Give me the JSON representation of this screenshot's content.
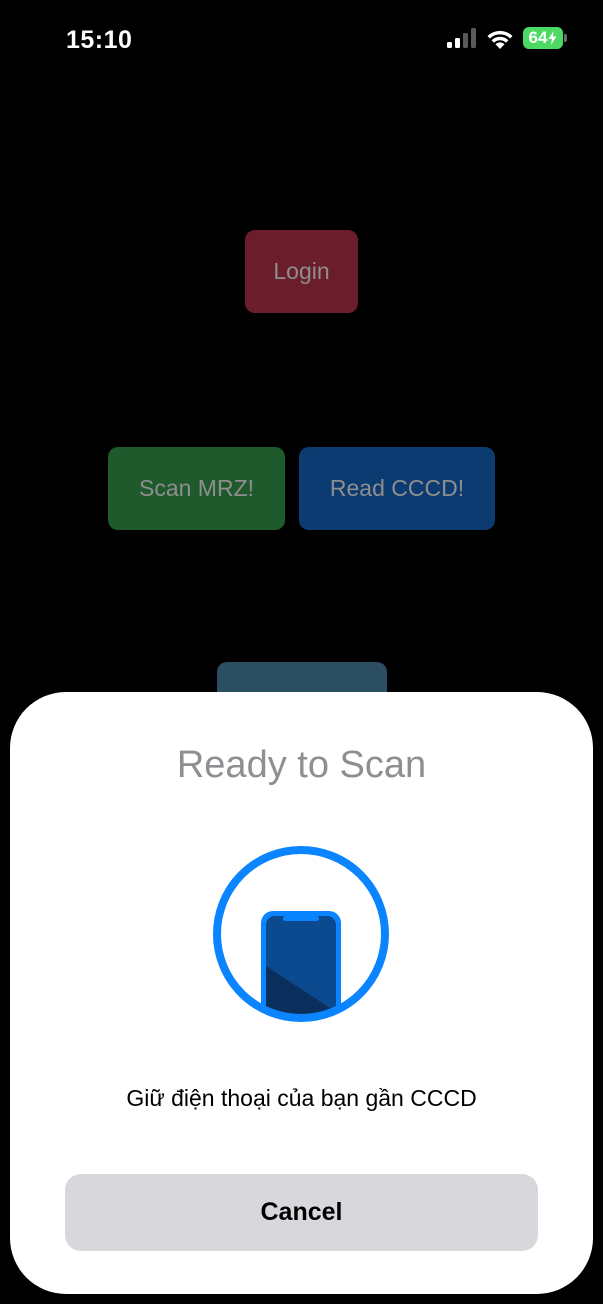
{
  "status_bar": {
    "time": "15:10",
    "battery_level": "64",
    "battery_color": "#4cd964"
  },
  "app": {
    "login_label": "Login",
    "scan_mrz_label": "Scan MRZ!",
    "read_cccd_label": "Read CCCD!",
    "colors": {
      "login": "#6b1d2c",
      "scan_mrz": "#1e5a2b",
      "read_cccd": "#0b3b70"
    }
  },
  "scan_sheet": {
    "title": "Ready to Scan",
    "message": "Giữ điện thoại của bạn gần CCCD",
    "cancel_label": "Cancel",
    "icon": "phone-nfc-scan-icon",
    "accent": "#0a84ff"
  }
}
